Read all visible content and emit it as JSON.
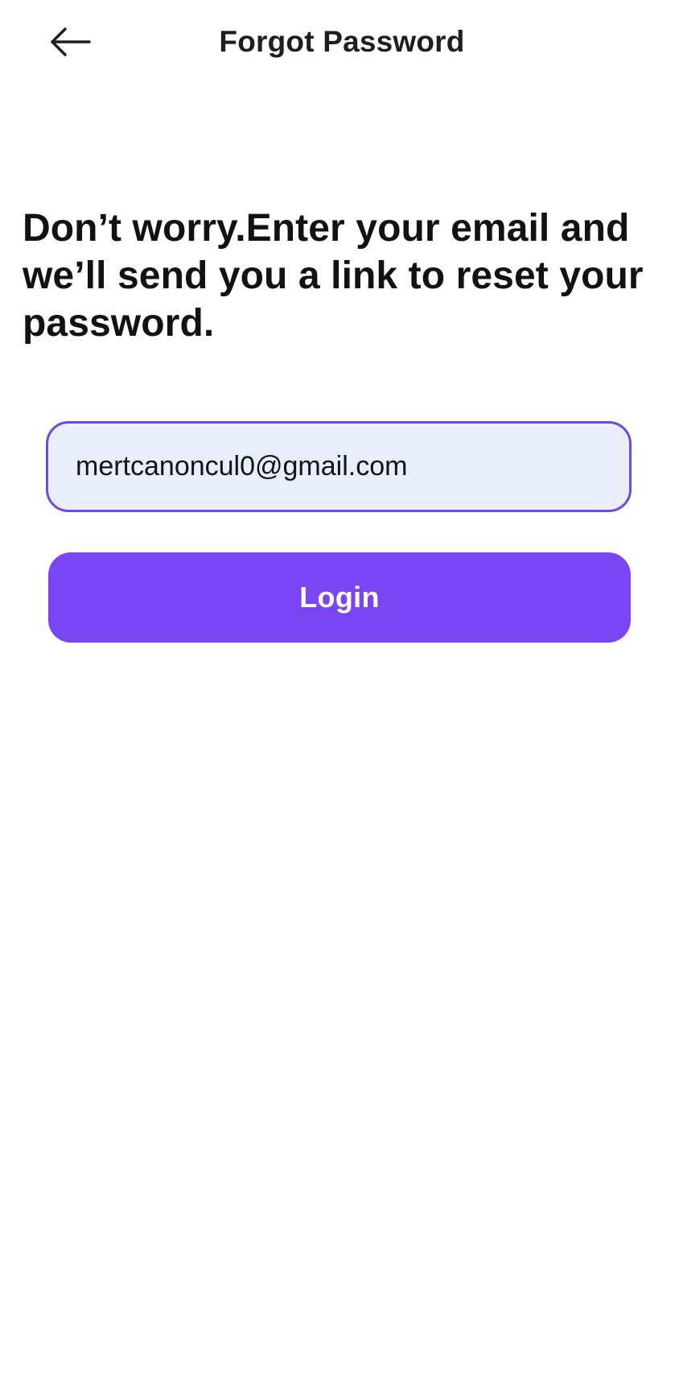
{
  "header": {
    "title": "Forgot Password",
    "back_icon": "arrow-left-icon"
  },
  "main": {
    "instructions": "Don’t worry.Enter your email and we’ll send you a link to reset your password.",
    "email_value": "mertcanoncul0@gmail.com",
    "login_label": "Login"
  },
  "colors": {
    "accent": "#7a45f5",
    "input_border": "#7249e0",
    "input_background": "#e8eefc",
    "text": "#121212",
    "background": "#ffffff"
  }
}
